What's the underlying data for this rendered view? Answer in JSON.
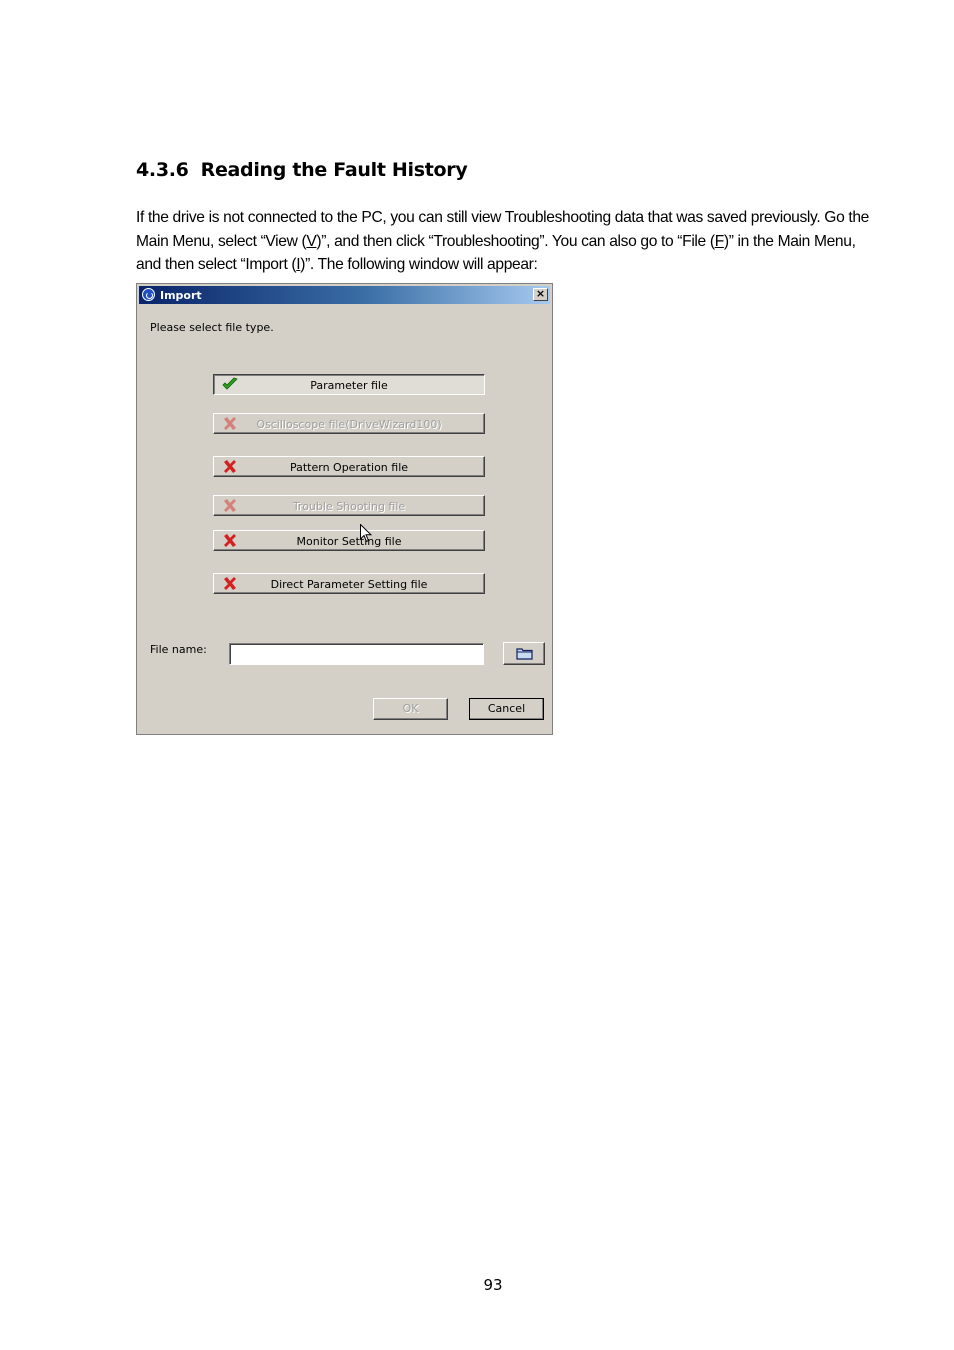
{
  "section": {
    "number": "4.3.6",
    "title": "Reading the Fault History"
  },
  "paragraph": {
    "s1": "If the drive is not connected to the PC, you can still view Troubleshooting data that was saved previously. Go the Main Menu, select “View (",
    "k1": "V",
    "s2": ")”, and then click “Troubleshooting”. You can also go to “File (",
    "k2": "F",
    "s3": ")” in the Main Menu, and then select “Import (",
    "k3": "I",
    "s4": ")”. The following window will appear:"
  },
  "dialog": {
    "title": "Import",
    "close_glyph": "×",
    "prompt": "Please select file type.",
    "file_types": [
      {
        "label": "Parameter file",
        "status": "check",
        "enabled": true
      },
      {
        "label": "Oscilloscope file(DriveWizard100)",
        "status": "cross",
        "enabled": false
      },
      {
        "label": "Pattern Operation file",
        "status": "cross",
        "enabled": true
      },
      {
        "label": "Trouble Shooting file",
        "status": "cross",
        "enabled": false
      },
      {
        "label": "Monitor Setting file",
        "status": "cross",
        "enabled": true
      },
      {
        "label": "Direct Parameter Setting file",
        "status": "cross",
        "enabled": true
      }
    ],
    "file_name_label": "File name:",
    "file_name_value": "",
    "ok_label": "OK",
    "cancel_label": "Cancel"
  },
  "colors": {
    "check": "#2ea01e",
    "cross": "#d42020",
    "titlebar_start": "#0a246a",
    "titlebar_end": "#a6caf0"
  },
  "page_number": "93"
}
